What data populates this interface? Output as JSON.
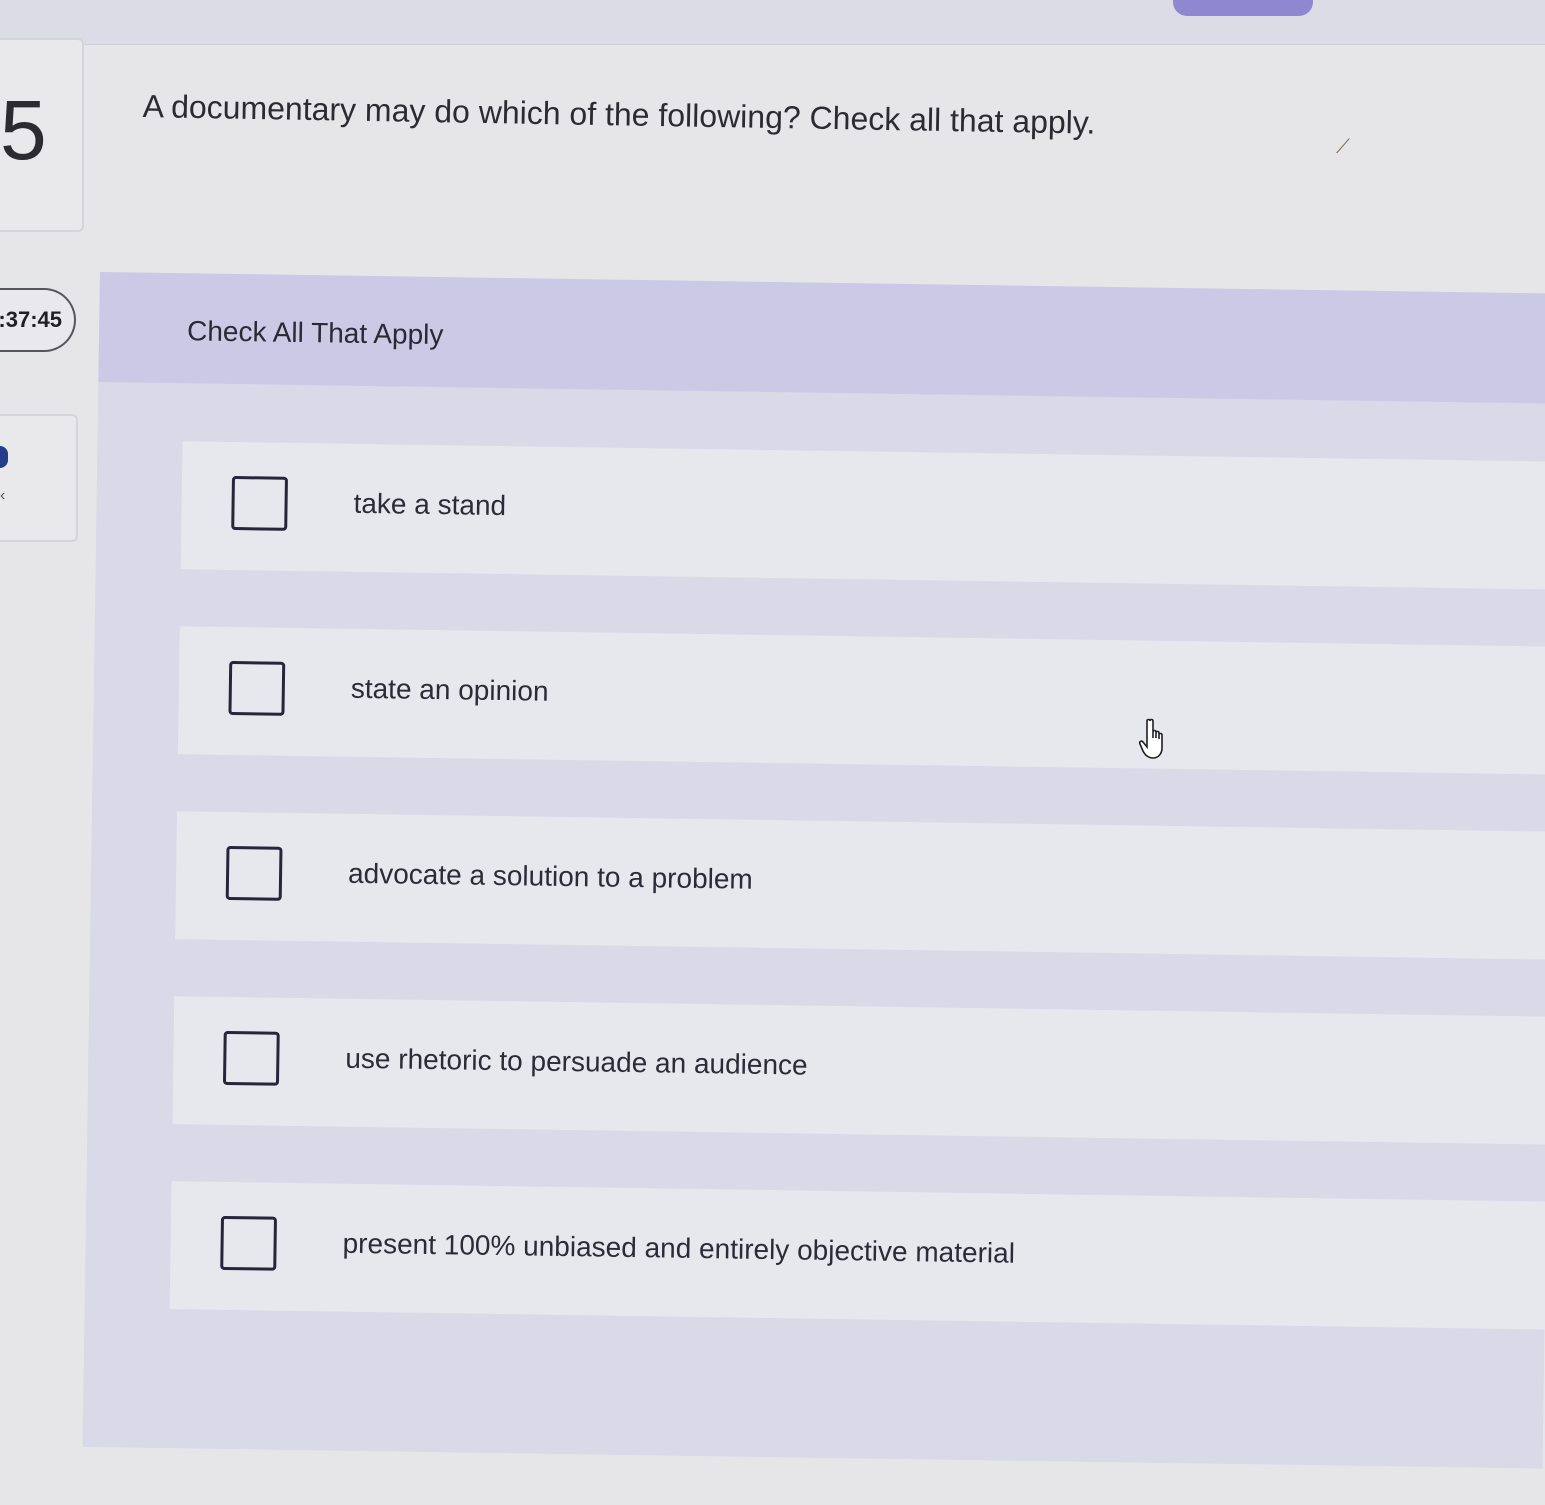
{
  "question": {
    "number": "5",
    "text": "A documentary may do which of the following? Check all that apply."
  },
  "timer": {
    "value": ":37:45"
  },
  "panel": {
    "header_label": "Check All That Apply",
    "options": [
      {
        "label": "take a stand",
        "checked": false
      },
      {
        "label": "state an opinion",
        "checked": false
      },
      {
        "label": "advocate a solution to a problem",
        "checked": false
      },
      {
        "label": "use rhetoric to persuade an audience",
        "checked": false
      },
      {
        "label": "present 100% unbiased and entirely objective material",
        "checked": false
      }
    ]
  },
  "colors": {
    "accent": "#8f87cf",
    "header_bg": "#cbc9e6",
    "panel_bg": "#d9d9e8",
    "option_bg": "#e7e7ee",
    "checkbox_border": "#26263a"
  },
  "icons": {
    "cursor": "hand-pointer-icon",
    "side_chevron": "chevron-left-icon"
  }
}
